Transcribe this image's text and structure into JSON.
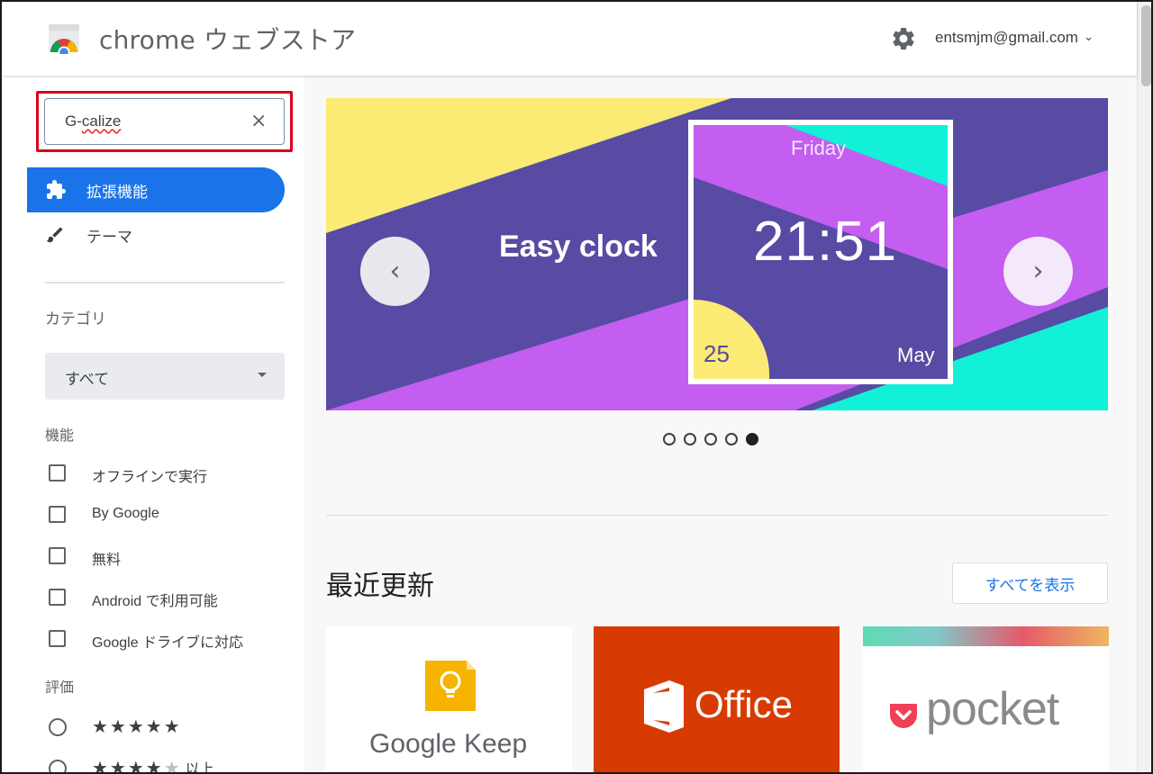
{
  "header": {
    "app_title": "chrome ウェブストア",
    "account": "entsmjm@gmail.com",
    "icons": [
      "chrome-web-store-logo",
      "gear-icon",
      "chevron-down-icon"
    ]
  },
  "sidebar": {
    "search_value": "G-calize",
    "search_prefix": "G-",
    "search_misspelled": "calize",
    "clear_symbol": "×",
    "nav": [
      {
        "label": "拡張機能",
        "icon": "puzzle-piece-icon",
        "active": true
      },
      {
        "label": "テーマ",
        "icon": "paintbrush-icon",
        "active": false
      }
    ],
    "category_heading": "カテゴリ",
    "category_selected": "すべて",
    "features_heading": "機能",
    "features": [
      "オフラインで実行",
      "By Google",
      "無料",
      "Android で利用可能",
      "Google ドライブに対応"
    ],
    "rating_heading": "評価",
    "ratings": [
      {
        "full": "★★★★★",
        "dim": "",
        "suffix": ""
      },
      {
        "full": "★★★★",
        "dim": "★",
        "suffix": "以上"
      }
    ]
  },
  "banner": {
    "title": "Easy clock",
    "clock_day": "Friday",
    "clock_time": "21:51",
    "clock_date": "25",
    "clock_month": "May",
    "prev_symbol": "‹",
    "next_symbol": "›",
    "slide_count": 5,
    "active_slide": 5,
    "colors": {
      "yellow": "#fbeb74",
      "indigo": "#574ba3",
      "magenta": "#c35ef0",
      "cyan": "#13f0d8"
    }
  },
  "recent": {
    "title": "最近更新",
    "show_all": "すべてを表示",
    "cards": [
      {
        "name": "Google Keep",
        "bg": "#ffffff"
      },
      {
        "name": "Office",
        "bg": "#d83b01"
      },
      {
        "name": "pocket",
        "bg": "#ffffff"
      }
    ]
  },
  "colors": {
    "accent": "#1a73e8",
    "highlight_border": "#d9001b"
  }
}
